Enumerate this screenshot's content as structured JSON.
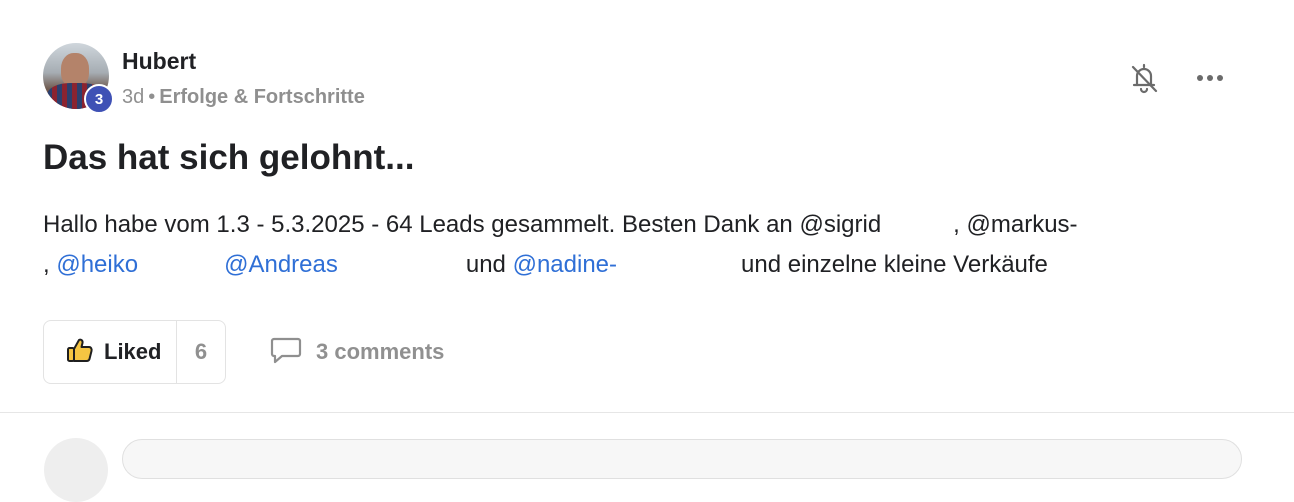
{
  "post": {
    "author": "Hubert",
    "level": "3",
    "age": "3d",
    "separator": "•",
    "category": "Erfolge & Fortschritte",
    "title": "Das hat sich gelohnt...",
    "body": {
      "line1_text": "Hallo habe vom 1.3 - 5.3.2025 - 64 Leads gesammelt. Besten Dank an ",
      "mention_sigrid": "@sigrid",
      "comma_after_sigrid": ",",
      "mention_markus": "@markus-",
      "line2_comma": ",",
      "mention_heiko": "@heiko",
      "mention_andreas": "@Andreas",
      "und1": "und",
      "mention_nadine": "@nadine-",
      "line2_tail": "und einzelne kleine Verkäufe"
    }
  },
  "actions": {
    "like_label": "Liked",
    "like_count": "6",
    "comments_label": "3 comments"
  },
  "icons": {
    "bell": "bell-off-icon",
    "more": "more-horizontal-icon",
    "thumb": "thumbs-up-icon",
    "comment": "comment-icon"
  },
  "colors": {
    "mention": "#2f6fd6",
    "level_badge": "#3f51b5",
    "thumb_fill": "#f5c542"
  }
}
